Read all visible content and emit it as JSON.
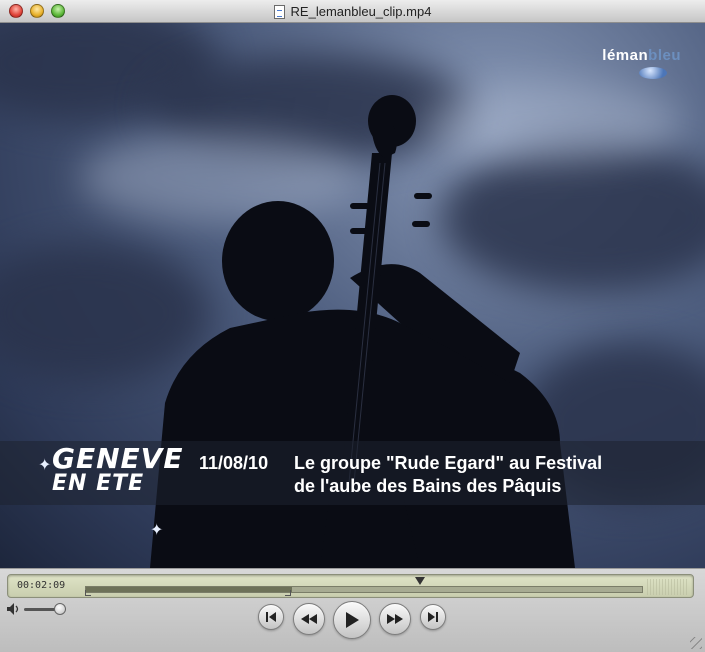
{
  "window": {
    "title": "RE_lemanbleu_clip.mp4"
  },
  "video": {
    "logo": {
      "part1": "léman",
      "part2": "bleu"
    },
    "lower_third": {
      "show_line1": "GENEVE",
      "show_line2": "EN ETE",
      "date": "11/08/10",
      "caption_line1": "Le groupe \"Rude Egard\" au Festival",
      "caption_line2": "de l'aube des Bains des Pâquis"
    }
  },
  "controller": {
    "current_time": "00:02:09",
    "playback_progress": 0.6,
    "selection_start": 0.0,
    "selection_end": 0.37,
    "volume_level": 0.85
  },
  "colors": {
    "lcd": "#d5d9bb",
    "sky": "#4f5f80",
    "silhouette": "#0a0c14"
  }
}
